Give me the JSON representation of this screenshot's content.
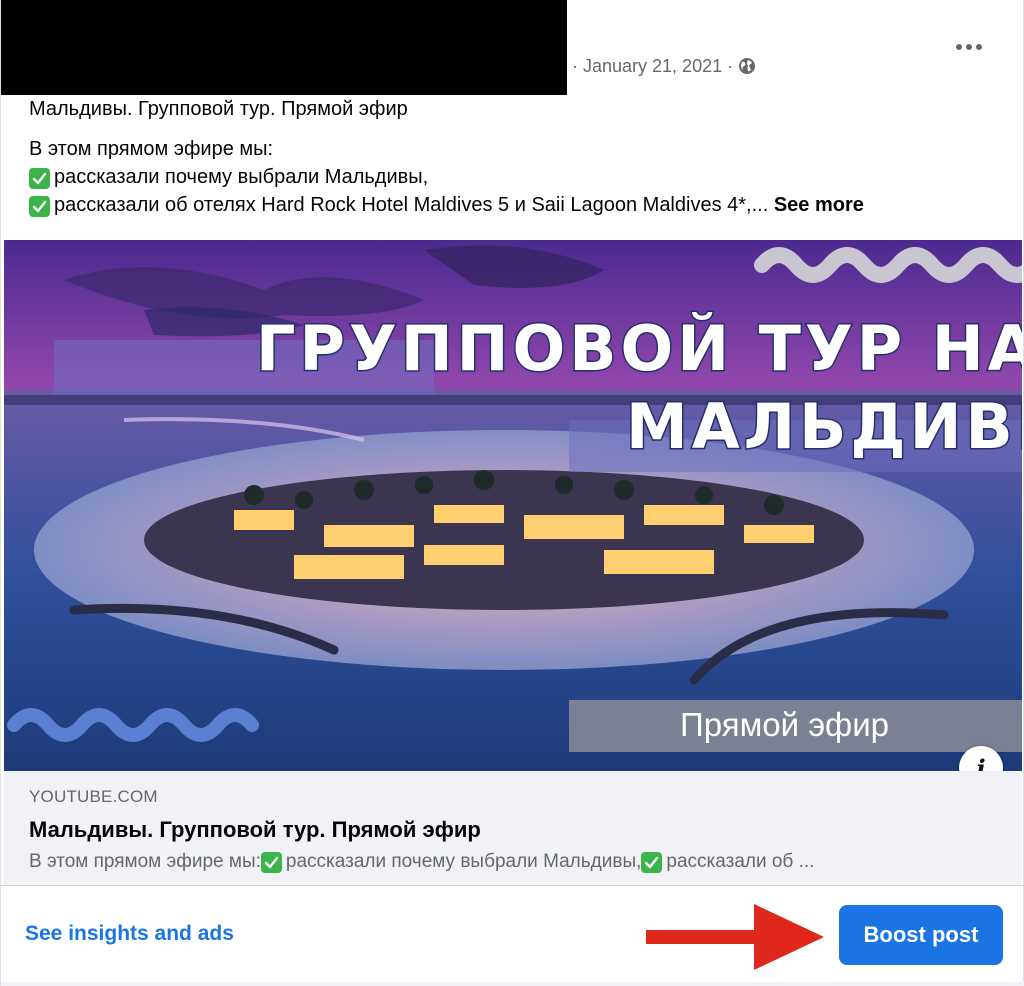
{
  "post": {
    "date": "January 21, 2021",
    "separator_a": "·",
    "separator_b": "·",
    "privacy_icon": "globe-icon",
    "more_icon": "more-options-icon",
    "text": {
      "title": "Мальдивы. Групповой тур. Прямой эфир",
      "intro": "В этом прямом эфире мы:",
      "item1": "рассказали почему выбрали Мальдивы,",
      "item2": "рассказали об отелях Hard Rock Hotel Maldives 5 и Saii Lagoon Maldives 4*,...",
      "see_more": "See more"
    }
  },
  "thumbnail": {
    "headline_line1": "ГРУППОВОЙ ТУР НА",
    "headline_line2": "МАЛЬДИВЫ",
    "badge": "Прямой эфир",
    "info_icon": "info-icon"
  },
  "link_preview": {
    "domain": "YOUTUBE.COM",
    "title": "Мальдивы. Групповой тур. Прямой эфир",
    "desc_part1": "В этом прямом эфире мы:",
    "desc_part2": "рассказали почему выбрали Мальдивы,",
    "desc_part3": "рассказали об ..."
  },
  "actions": {
    "insights_label": "See insights and ads",
    "boost_label": "Boost post"
  },
  "colors": {
    "accent": "#1b74e4",
    "arrow": "#e0271c",
    "check": "#3bb54a"
  }
}
